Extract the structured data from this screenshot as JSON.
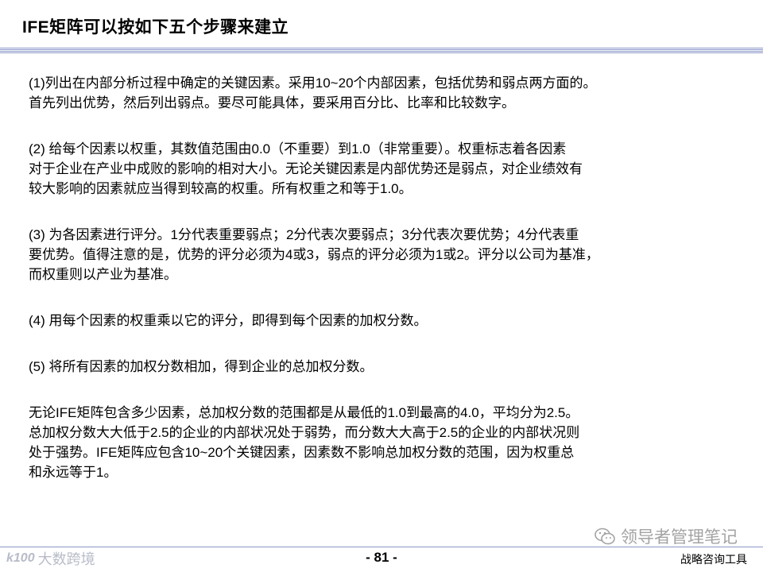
{
  "slide": {
    "title": "IFE矩阵可以按如下五个步骤来建立"
  },
  "paragraphs": [
    "(1)列出在内部分析过程中确定的关键因素。采用10~20个内部因素，包括优势和弱点两方面的。\n首先列出优势，然后列出弱点。要尽可能具体，要采用百分比、比率和比较数字。",
    "(2) 给每个因素以权重，其数值范围由0.0（不重要）到1.0（非常重要）。权重标志着各因素\n对于企业在产业中成败的影响的相对大小。无论关键因素是内部优势还是弱点，对企业绩效有\n较大影响的因素就应当得到较高的权重。所有权重之和等于1.0。",
    "(3) 为各因素进行评分。1分代表重要弱点；2分代表次要弱点；3分代表次要优势；4分代表重\n要优势。值得注意的是，优势的评分必须为4或3，弱点的评分必须为1或2。评分以公司为基准，\n而权重则以产业为基准。",
    "(4) 用每个因素的权重乘以它的评分，即得到每个因素的加权分数。",
    "(5) 将所有因素的加权分数相加，得到企业的总加权分数。",
    "无论IFE矩阵包含多少因素，总加权分数的范围都是从最低的1.0到最高的4.0，平均分为2.5。\n总加权分数大大低于2.5的企业的内部状况处于弱势，而分数大大高于2.5的企业的内部状况则\n处于强势。IFE矩阵应包含10~20个关键因素，因素数不影响总加权分数的范围，因为权重总\n和永远等于1。"
  ],
  "watermark": {
    "icon": "wechat-icon",
    "text": "领导者管理笔记"
  },
  "footer": {
    "logo_mark": "k100",
    "logo_text": "大数跨境",
    "page_number": "- 81 -",
    "label": "战略咨询工具"
  },
  "colors": {
    "rule": "#8a96c8",
    "watermark": "#9a9a9a",
    "logo": "#b8bcc8"
  }
}
